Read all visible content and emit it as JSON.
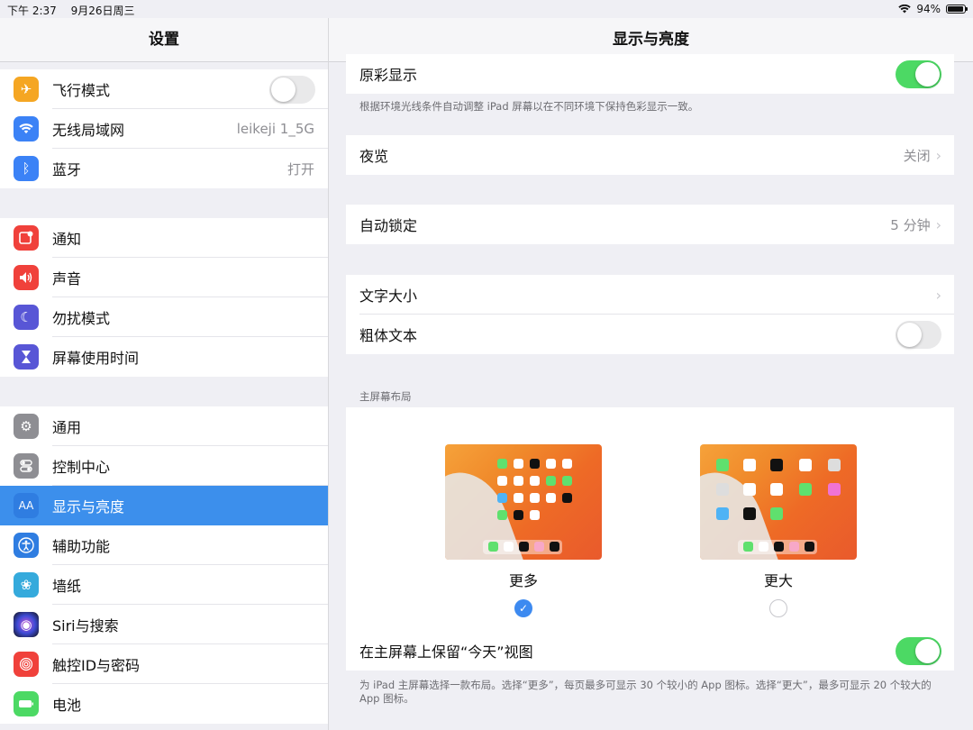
{
  "status": {
    "time": "下午 2:37",
    "date": "9月26日周三",
    "battery": "94%"
  },
  "left": {
    "title": "设置",
    "group1": [
      {
        "label": "飞行模式",
        "icon": "airplane-icon",
        "color": "#f5a623",
        "glyph": "✈",
        "toggle": "off"
      },
      {
        "label": "无线局域网",
        "icon": "wifi-icon",
        "color": "#3b82f6",
        "glyph": "≋",
        "value": "leikeji 1_5G"
      },
      {
        "label": "蓝牙",
        "icon": "bluetooth-icon",
        "color": "#3b82f6",
        "glyph": "ᛒ",
        "value": "打开"
      }
    ],
    "group2": [
      {
        "label": "通知",
        "icon": "notifications-icon",
        "color": "#f0413b",
        "glyph": "◩"
      },
      {
        "label": "声音",
        "icon": "sound-icon",
        "color": "#f0413b",
        "glyph": "◀"
      },
      {
        "label": "勿扰模式",
        "icon": "moon-icon",
        "color": "#5856d6",
        "glyph": "☾"
      },
      {
        "label": "屏幕使用时间",
        "icon": "hourglass-icon",
        "color": "#5856d6",
        "glyph": "⧗"
      }
    ],
    "group3": [
      {
        "label": "通用",
        "icon": "gear-icon",
        "color": "#8e8e93",
        "glyph": "⚙"
      },
      {
        "label": "控制中心",
        "icon": "switches-icon",
        "color": "#8e8e93",
        "glyph": "⊟"
      },
      {
        "label": "显示与亮度",
        "icon": "display-brightness-icon",
        "color": "#2f7de1",
        "glyph": "AA",
        "selected": true
      },
      {
        "label": "辅助功能",
        "icon": "accessibility-icon",
        "color": "#2f7de1",
        "glyph": "☺"
      },
      {
        "label": "墙纸",
        "icon": "wallpaper-icon",
        "color": "#35aadc",
        "glyph": "❀"
      },
      {
        "label": "Siri与搜索",
        "icon": "siri-icon",
        "color": "#222244",
        "glyph": "◉"
      },
      {
        "label": "触控ID与密码",
        "icon": "fingerprint-icon",
        "color": "#f0413b",
        "glyph": "◎"
      },
      {
        "label": "电池",
        "icon": "battery-icon",
        "color": "#4cd964",
        "glyph": "▭"
      }
    ]
  },
  "right": {
    "title": "显示与亮度",
    "true_tone": {
      "label": "原彩显示",
      "toggle": "on",
      "footnote": "根据环境光线条件自动调整 iPad 屏幕以在不同环境下保持色彩显示一致。"
    },
    "night_shift": {
      "label": "夜览",
      "value": "关闭"
    },
    "auto_lock": {
      "label": "自动锁定",
      "value": "5 分钟"
    },
    "text_size": {
      "label": "文字大小"
    },
    "bold_text": {
      "label": "粗体文本",
      "toggle": "off"
    },
    "home_layout_header": "主屏幕布局",
    "layout_more": {
      "label": "更多",
      "selected": true
    },
    "layout_bigger": {
      "label": "更大",
      "selected": false
    },
    "keep_today": {
      "label": "在主屏幕上保留“今天”视图",
      "toggle": "on"
    },
    "layout_footnote": "为 iPad 主屏幕选择一款布局。选择“更多”，每页最多可显示 30 个较小的 App 图标。选择“更大”，最多可显示 20 个较大的 App 图标。"
  }
}
